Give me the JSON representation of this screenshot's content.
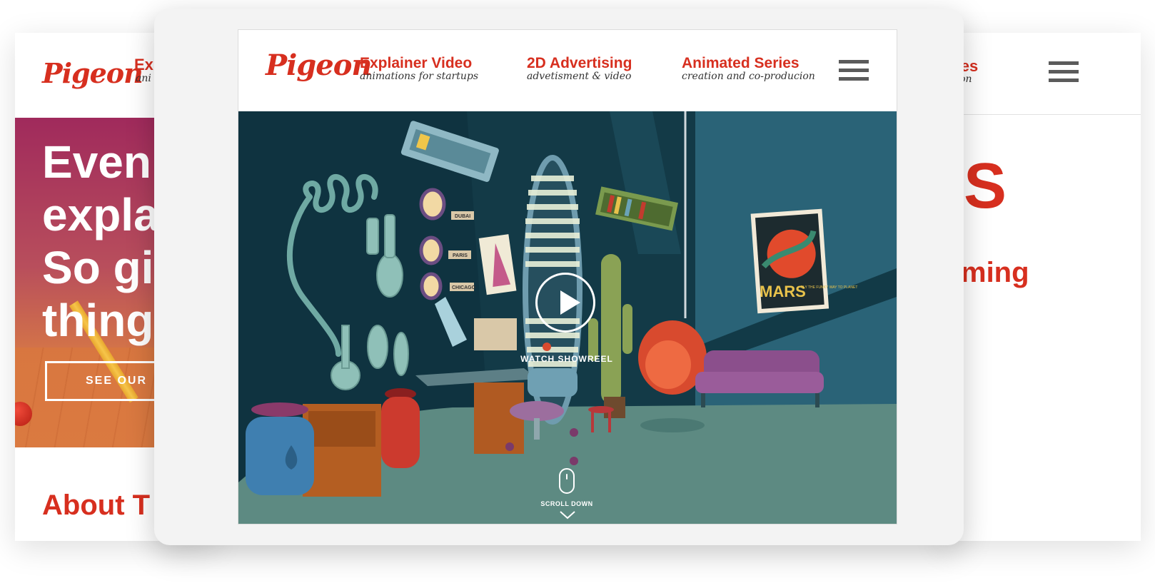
{
  "brand": {
    "logo_text": "Pigeon",
    "accent_color": "#d72f1f"
  },
  "nav": [
    {
      "title": "Explainer Video",
      "subtitle": "animations for startups"
    },
    {
      "title": "2D Advertising",
      "subtitle": "advetisment & video"
    },
    {
      "title": "Animated Series",
      "subtitle": "creation and co-producion"
    }
  ],
  "hero": {
    "play_label": "WATCH SHOWREEL",
    "scroll_label": "SCROLL DOWN",
    "labels": {
      "tag_1": "DUBAI",
      "tag_2": "PARIS",
      "tag_3": "CHICAGO",
      "poster_title": "MARS",
      "poster_small": "FLY THE FUNKY WAY TO PLANET"
    }
  },
  "back_left": {
    "nav_title": "Ex",
    "nav_sub": "ani",
    "hero_lines": [
      "Even",
      "expla",
      "So gi",
      "thing"
    ],
    "button_label": "SEE OUR",
    "section_heading": "About T"
  },
  "back_right": {
    "nav_title": "l Series",
    "nav_sub": "-producion",
    "big_letter": "S",
    "word": "ming"
  }
}
